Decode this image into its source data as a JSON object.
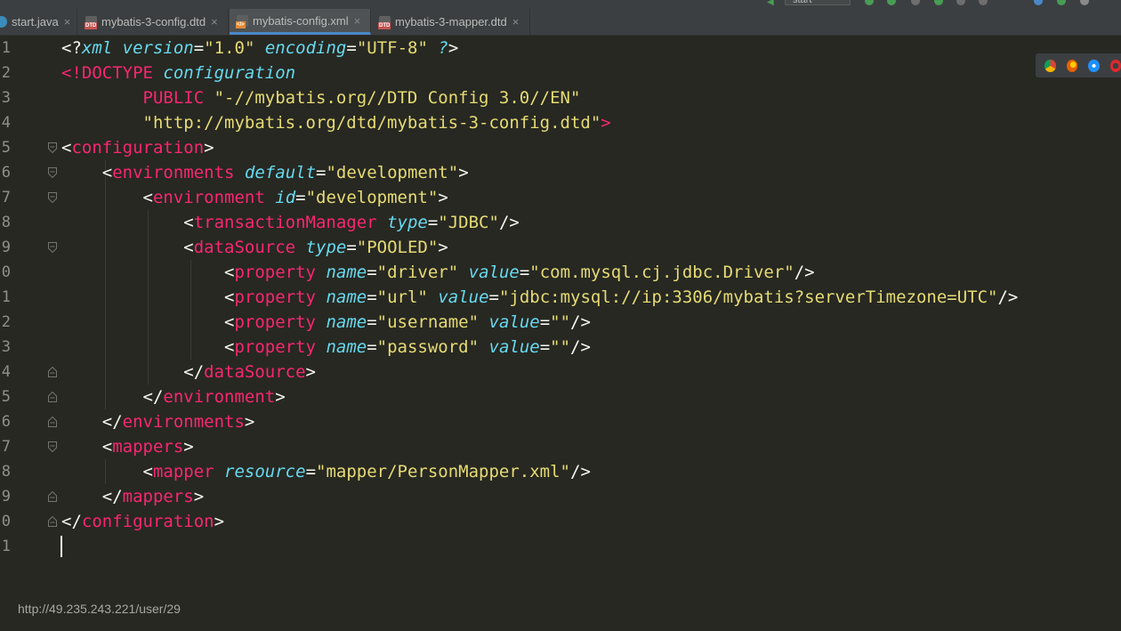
{
  "tabs": [
    {
      "label": "start.java",
      "icon": "java-file-icon"
    },
    {
      "label": "mybatis-3-config.dtd",
      "icon": "dtd-file-icon"
    },
    {
      "label": "mybatis-config.xml",
      "icon": "xml-file-icon",
      "active": true
    },
    {
      "label": "mybatis-3-mapper.dtd",
      "icon": "dtd-file-icon"
    }
  ],
  "toolbar": {
    "run_config": "start"
  },
  "editor": {
    "line_numbers": [
      "1",
      "2",
      "3",
      "4",
      "5",
      "6",
      "7",
      "8",
      "9",
      "0",
      "1",
      "2",
      "3",
      "4",
      "5",
      "6",
      "7",
      "8",
      "9",
      "0",
      "1"
    ],
    "lines": [
      [
        [
          "ph",
          "<?"
        ],
        [
          "attr",
          "xml"
        ],
        [
          "ph",
          " "
        ],
        [
          "attr",
          "version"
        ],
        [
          "ph",
          "="
        ],
        [
          "str",
          "\"1.0\""
        ],
        [
          "ph",
          " "
        ],
        [
          "attr",
          "encoding"
        ],
        [
          "ph",
          "="
        ],
        [
          "str",
          "\"UTF-8\""
        ],
        [
          "ph",
          " "
        ],
        [
          "attr",
          "?"
        ],
        [
          "ph",
          ">"
        ]
      ],
      [
        [
          "kw",
          "<!DOCTYPE "
        ],
        [
          "attr",
          "configuration"
        ]
      ],
      [
        [
          "ph",
          "        "
        ],
        [
          "kw",
          "PUBLIC "
        ],
        [
          "str",
          "\"-//mybatis.org//DTD Config 3.0//EN\""
        ]
      ],
      [
        [
          "ph",
          "        "
        ],
        [
          "str",
          "\"http://mybatis.org/dtd/mybatis-3-config.dtd\""
        ],
        [
          "kw",
          ">"
        ]
      ],
      [
        [
          "ph",
          "<"
        ],
        [
          "tag",
          "configuration"
        ],
        [
          "ph",
          ">"
        ]
      ],
      [
        [
          "ph",
          "    <"
        ],
        [
          "tag",
          "environments"
        ],
        [
          "ph",
          " "
        ],
        [
          "attr",
          "default"
        ],
        [
          "ph",
          "="
        ],
        [
          "str",
          "\"development\""
        ],
        [
          "ph",
          ">"
        ]
      ],
      [
        [
          "ph",
          "        <"
        ],
        [
          "tag",
          "environment"
        ],
        [
          "ph",
          " "
        ],
        [
          "attr",
          "id"
        ],
        [
          "ph",
          "="
        ],
        [
          "str",
          "\"development\""
        ],
        [
          "ph",
          ">"
        ]
      ],
      [
        [
          "ph",
          "            <"
        ],
        [
          "tag",
          "transactionManager"
        ],
        [
          "ph",
          " "
        ],
        [
          "attr",
          "type"
        ],
        [
          "ph",
          "="
        ],
        [
          "str",
          "\"JDBC\""
        ],
        [
          "ph",
          "/>"
        ]
      ],
      [
        [
          "ph",
          "            <"
        ],
        [
          "tag",
          "dataSource"
        ],
        [
          "ph",
          " "
        ],
        [
          "attr",
          "type"
        ],
        [
          "ph",
          "="
        ],
        [
          "str",
          "\"POOLED\""
        ],
        [
          "ph",
          ">"
        ]
      ],
      [
        [
          "ph",
          "                <"
        ],
        [
          "tag",
          "property"
        ],
        [
          "ph",
          " "
        ],
        [
          "attr",
          "name"
        ],
        [
          "ph",
          "="
        ],
        [
          "str",
          "\"driver\""
        ],
        [
          "ph",
          " "
        ],
        [
          "attr",
          "value"
        ],
        [
          "ph",
          "="
        ],
        [
          "str",
          "\"com.mysql.cj.jdbc.Driver\""
        ],
        [
          "ph",
          "/>"
        ]
      ],
      [
        [
          "ph",
          "                <"
        ],
        [
          "tag",
          "property"
        ],
        [
          "ph",
          " "
        ],
        [
          "attr",
          "name"
        ],
        [
          "ph",
          "="
        ],
        [
          "str",
          "\"url\""
        ],
        [
          "ph",
          " "
        ],
        [
          "attr",
          "value"
        ],
        [
          "ph",
          "="
        ],
        [
          "str",
          "\"jdbc:mysql://ip:3306/mybatis?serverTimezone=UTC\""
        ],
        [
          "ph",
          "/>"
        ]
      ],
      [
        [
          "ph",
          "                <"
        ],
        [
          "tag",
          "property"
        ],
        [
          "ph",
          " "
        ],
        [
          "attr",
          "name"
        ],
        [
          "ph",
          "="
        ],
        [
          "str",
          "\"username\""
        ],
        [
          "ph",
          " "
        ],
        [
          "attr",
          "value"
        ],
        [
          "ph",
          "="
        ],
        [
          "str",
          "\"\""
        ],
        [
          "ph",
          "/>"
        ]
      ],
      [
        [
          "ph",
          "                <"
        ],
        [
          "tag",
          "property"
        ],
        [
          "ph",
          " "
        ],
        [
          "attr",
          "name"
        ],
        [
          "ph",
          "="
        ],
        [
          "str",
          "\"password\""
        ],
        [
          "ph",
          " "
        ],
        [
          "attr",
          "value"
        ],
        [
          "ph",
          "="
        ],
        [
          "str",
          "\"\""
        ],
        [
          "ph",
          "/>"
        ]
      ],
      [
        [
          "ph",
          "            </"
        ],
        [
          "tag",
          "dataSource"
        ],
        [
          "ph",
          ">"
        ]
      ],
      [
        [
          "ph",
          "        </"
        ],
        [
          "tag",
          "environment"
        ],
        [
          "ph",
          ">"
        ]
      ],
      [
        [
          "ph",
          "    </"
        ],
        [
          "tag",
          "environments"
        ],
        [
          "ph",
          ">"
        ]
      ],
      [
        [
          "ph",
          "    <"
        ],
        [
          "tag",
          "mappers"
        ],
        [
          "ph",
          ">"
        ]
      ],
      [
        [
          "ph",
          "        <"
        ],
        [
          "tag",
          "mapper"
        ],
        [
          "ph",
          " "
        ],
        [
          "attr",
          "resource"
        ],
        [
          "ph",
          "="
        ],
        [
          "str",
          "\"mapper/PersonMapper.xml\""
        ],
        [
          "ph",
          "/>"
        ]
      ],
      [
        [
          "ph",
          "    </"
        ],
        [
          "tag",
          "mappers"
        ],
        [
          "ph",
          ">"
        ]
      ],
      [
        [
          "ph",
          "</"
        ],
        [
          "tag",
          "configuration"
        ],
        [
          "ph",
          ">"
        ]
      ],
      []
    ],
    "fold_open_lines": [
      5,
      6,
      7,
      9,
      17
    ],
    "fold_close_lines": [
      14,
      15,
      16,
      19,
      20
    ]
  },
  "browser_icons": [
    "chrome-icon",
    "firefox-icon",
    "safari-icon",
    "opera-icon"
  ],
  "status": {
    "url": "http://49.235.243.221/user/29"
  }
}
